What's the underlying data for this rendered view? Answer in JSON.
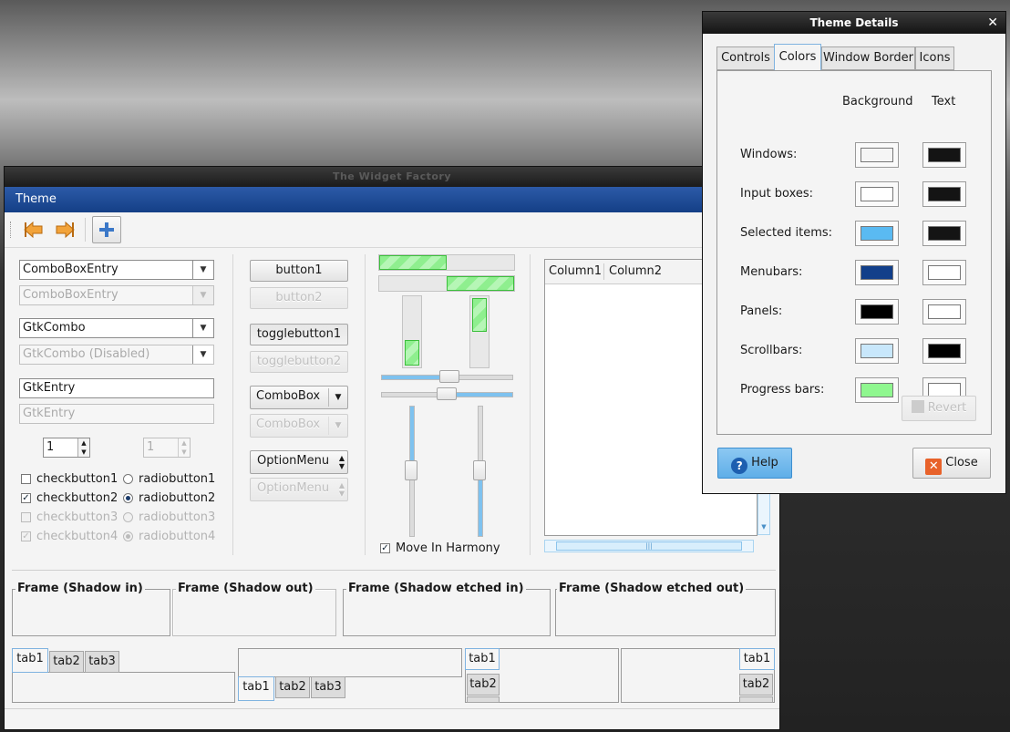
{
  "widget_factory": {
    "title": "The Widget Factory",
    "menubar": {
      "theme_label": "Theme"
    },
    "toolbar": {
      "back_icon": "arrow-left-icon",
      "forward_icon": "arrow-right-icon",
      "add_icon": "plus-icon"
    },
    "col1": {
      "combo_entry": "ComboBoxEntry",
      "combo_entry_disabled": "ComboBoxEntry",
      "gtk_combo": "GtkCombo",
      "gtk_combo_disabled": "GtkCombo (Disabled)",
      "gtk_entry": "GtkEntry",
      "gtk_entry_placeholder": "GtkEntry",
      "spin_value": "1",
      "spin_value_disabled": "1",
      "checks": [
        "checkbutton1",
        "checkbutton2",
        "checkbutton3",
        "checkbutton4"
      ],
      "radios": [
        "radiobutton1",
        "radiobutton2",
        "radiobutton3",
        "radiobutton4"
      ]
    },
    "col2": {
      "button1": "button1",
      "button2": "button2",
      "toggle1": "togglebutton1",
      "toggle2": "togglebutton2",
      "combobox": "ComboBox",
      "combobox_disabled": "ComboBox",
      "optionmenu": "OptionMenu",
      "optionmenu_disabled": "OptionMenu"
    },
    "col3": {
      "move_in_harmony": "Move In Harmony",
      "hbar1_fraction": 0.5,
      "hbar2_fraction": 0.5,
      "vbar1_fraction": 0.6,
      "vbar2_fraction": 0.6
    },
    "col4": {
      "column1": "Column1",
      "column2": "Column2"
    },
    "frames": [
      "Frame (Shadow in)",
      "Frame (Shadow out)",
      "Frame (Shadow etched in)",
      "Frame (Shadow etched out)"
    ],
    "tabs": [
      "tab1",
      "tab2",
      "tab3"
    ]
  },
  "theme_details": {
    "title": "Theme Details",
    "tabs": [
      "Controls",
      "Colors",
      "Window Border",
      "Icons"
    ],
    "active_tab": "Colors",
    "header_background": "Background",
    "header_text": "Text",
    "rows": [
      {
        "label": "Windows:",
        "bg": "#f5f5f5",
        "fg": "#141414"
      },
      {
        "label": "Input boxes:",
        "bg": "#ffffff",
        "fg": "#141414"
      },
      {
        "label": "Selected items:",
        "bg": "#5abaf2",
        "fg": "#141414"
      },
      {
        "label": "Menubars:",
        "bg": "#123f8a",
        "fg": "#ffffff"
      },
      {
        "label": "Panels:",
        "bg": "#000000",
        "fg": "#ffffff"
      },
      {
        "label": "Scrollbars:",
        "bg": "#c8e7fb",
        "fg": "#000000"
      },
      {
        "label": "Progress bars:",
        "bg": "#8ff78f",
        "fg": "#ffffff"
      }
    ],
    "revert_label": "Revert",
    "help_label": "Help",
    "close_label": "Close"
  }
}
